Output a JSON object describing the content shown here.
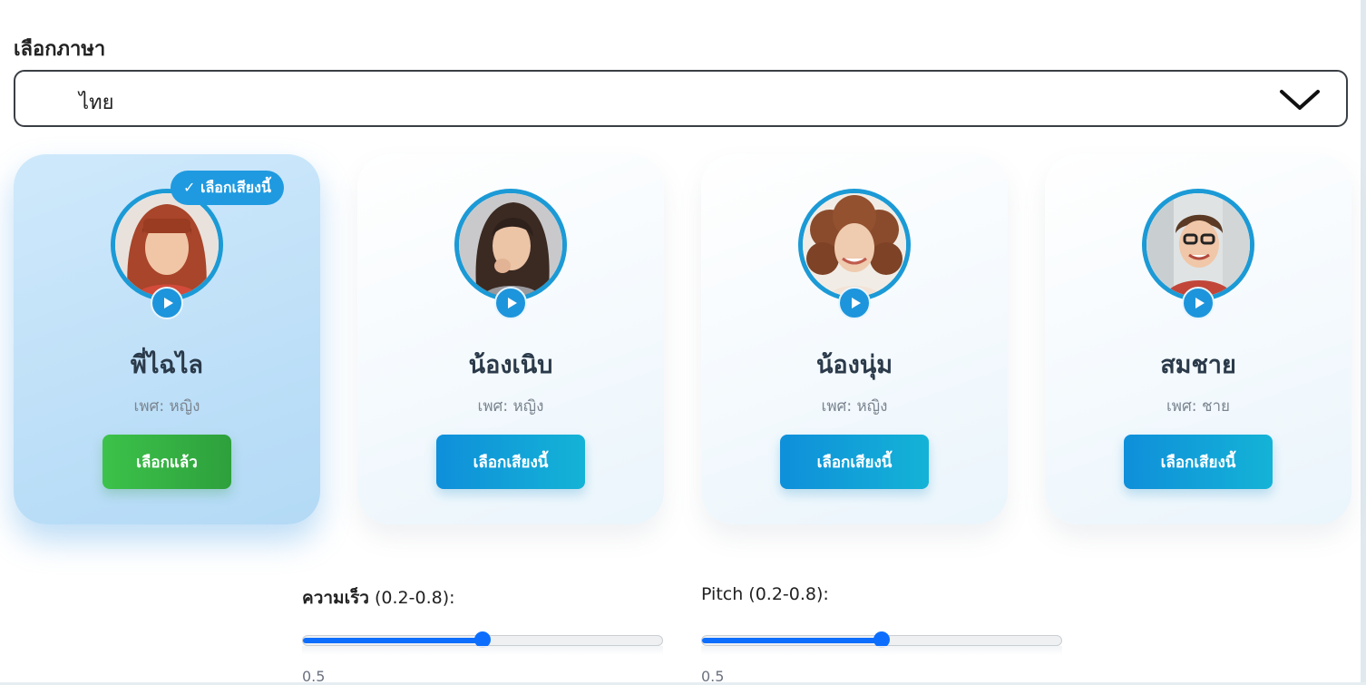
{
  "language": {
    "label": "เลือกภาษา",
    "selected": "ไทย"
  },
  "voices": [
    {
      "name": "พี่ไฉไล",
      "gender": "เพศ: หญิง",
      "button": "เลือกแล้ว",
      "badge": "✓ เลือกเสียงนี้",
      "selected": true
    },
    {
      "name": "น้องเนิบ",
      "gender": "เพศ: หญิง",
      "button": "เลือกเสียงนี้",
      "selected": false
    },
    {
      "name": "น้องนุ่ม",
      "gender": "เพศ: หญิง",
      "button": "เลือกเสียงนี้",
      "selected": false
    },
    {
      "name": "สมชาย",
      "gender": "เพศ: ชาย",
      "button": "เลือกเสียงนี้",
      "selected": false
    }
  ],
  "sliders": {
    "speed": {
      "label_bold": "ความเร็ว",
      "label_range": " (0.2-0.8):",
      "value": "0.5",
      "min": 0.2,
      "max": 0.8,
      "current": 0.5
    },
    "pitch": {
      "label": "Pitch (0.2-0.8):",
      "value": "0.5",
      "min": 0.2,
      "max": 0.8,
      "current": 0.5
    }
  },
  "colors": {
    "accent": "#1f9ae0",
    "selected_button": "#3cc24a",
    "slider": "#0d6efd"
  },
  "icons": [
    "chevron-down-icon",
    "play-icon",
    "check-icon"
  ]
}
